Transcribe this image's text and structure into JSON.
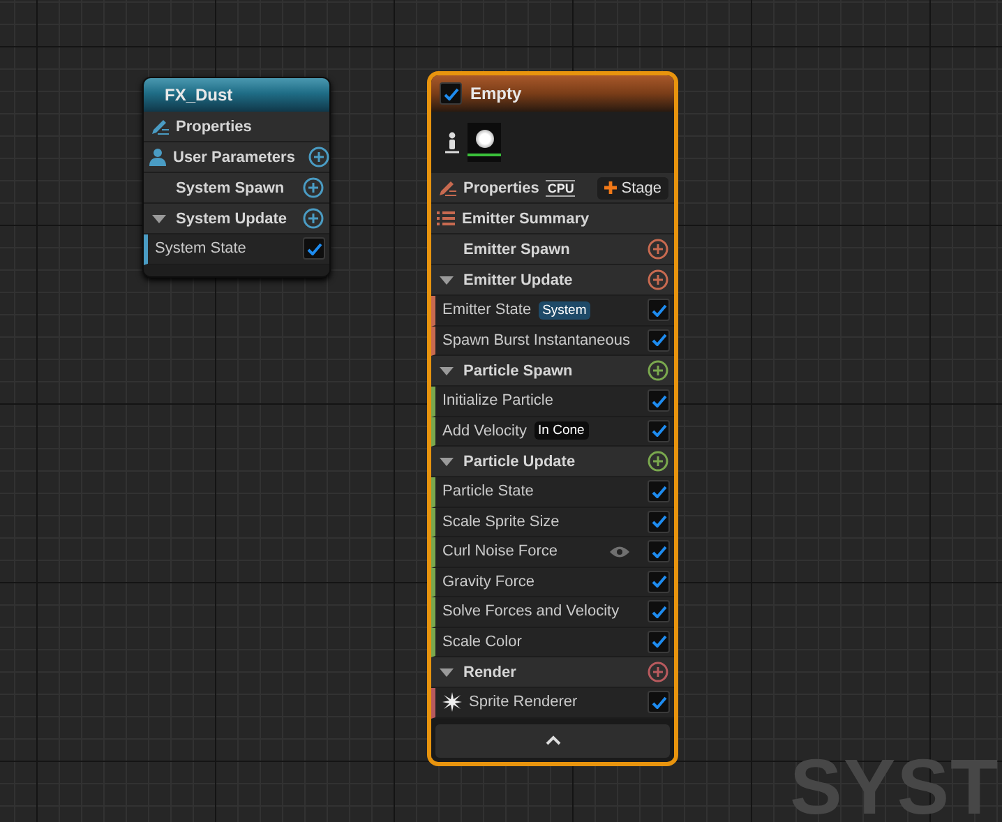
{
  "system_node": {
    "title": "FX_Dust",
    "properties": "Properties",
    "rows": [
      {
        "kind": "parameters",
        "label": "User Parameters",
        "color": "#4a9cc4"
      },
      {
        "kind": "section",
        "label": "System Spawn",
        "color": "#4a9cc4",
        "expanded": false
      },
      {
        "kind": "section",
        "label": "System Update",
        "color": "#4a9cc4",
        "expanded": true,
        "modules": [
          {
            "kind": "module",
            "label": "System State",
            "enabled": true
          }
        ]
      }
    ]
  },
  "emitter_node": {
    "enabled": true,
    "title": "Empty",
    "properties": "Properties",
    "sim_target": "CPU",
    "stage_button": "Stage",
    "summary": "Emitter Summary",
    "sections": [
      {
        "label": "Emitter Spawn",
        "color": "#c86a50",
        "expanded": false
      },
      {
        "label": "Emitter Update",
        "color": "#c86a50",
        "expanded": true,
        "modules": [
          {
            "kind": "module",
            "label": "Emitter State",
            "enabled": true,
            "tag": {
              "text": "System",
              "kind": "scope"
            }
          },
          {
            "kind": "module",
            "label": "Spawn Burst Instantaneous",
            "enabled": true
          }
        ]
      },
      {
        "label": "Particle Spawn",
        "color": "#7aa84e",
        "expanded": true,
        "modules": [
          {
            "kind": "module",
            "label": "Initialize Particle",
            "enabled": true
          },
          {
            "kind": "module",
            "label": "Add Velocity",
            "enabled": true,
            "tag": {
              "text": "In Cone",
              "kind": "mode"
            }
          }
        ]
      },
      {
        "label": "Particle Update",
        "color": "#7aa84e",
        "expanded": true,
        "modules": [
          {
            "kind": "module",
            "label": "Particle State",
            "enabled": true
          },
          {
            "kind": "module",
            "label": "Scale Sprite Size",
            "enabled": true
          },
          {
            "kind": "module",
            "label": "Curl Noise Force",
            "enabled": true,
            "preview_toggle": true
          },
          {
            "kind": "module",
            "label": "Gravity Force",
            "enabled": true
          },
          {
            "kind": "module",
            "label": "Solve Forces and Velocity",
            "enabled": true
          },
          {
            "kind": "module",
            "label": "Scale Color",
            "enabled": true
          }
        ]
      },
      {
        "label": "Render",
        "color": "#b85a5e",
        "expanded": true,
        "modules": [
          {
            "kind": "renderer",
            "label": "Sprite Renderer",
            "enabled": true
          }
        ]
      }
    ]
  },
  "canvas_label": "SYST"
}
